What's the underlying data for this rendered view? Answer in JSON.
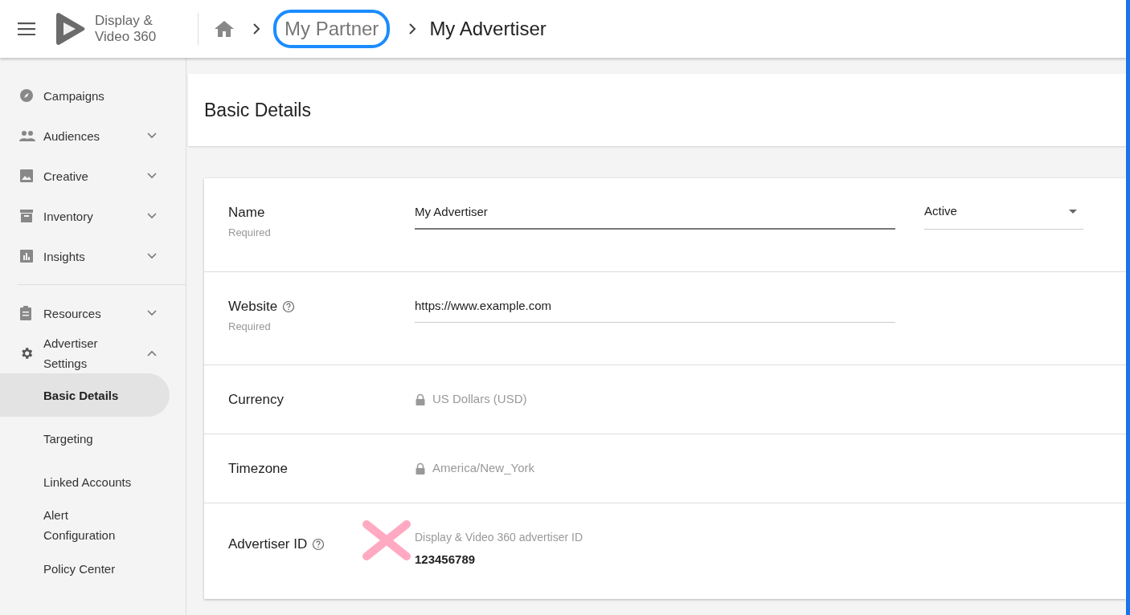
{
  "header": {
    "logo_text": [
      "Display &",
      "Video 360"
    ],
    "breadcrumbs": [
      {
        "label": "My Partner",
        "highlighted": true
      },
      {
        "label": "My Advertiser",
        "highlighted": false
      }
    ]
  },
  "sidebar": {
    "sections": [
      [
        {
          "label": "Campaigns",
          "kind": "link",
          "selected": false
        },
        {
          "label": "Audiences",
          "kind": "group",
          "expanded": false,
          "selected": false
        },
        {
          "label": "Creative",
          "kind": "group",
          "expanded": false,
          "selected": false
        },
        {
          "label": "Inventory",
          "kind": "group",
          "expanded": false,
          "selected": false
        },
        {
          "label": "Insights",
          "kind": "group",
          "expanded": false,
          "selected": false
        }
      ],
      [
        {
          "label": "Resources",
          "kind": "group",
          "expanded": false,
          "selected": false
        },
        {
          "label": "Advertiser Settings",
          "kind": "group",
          "expanded": true,
          "selected": false,
          "children": [
            {
              "label": "Basic Details",
              "selected": true
            },
            {
              "label": "Targeting",
              "selected": false
            },
            {
              "label": "Linked Accounts",
              "selected": false
            },
            {
              "label": "Alert Configuration",
              "selected": false
            },
            {
              "label": "Policy Center",
              "selected": false
            }
          ]
        }
      ]
    ]
  },
  "page_title": "Basic Details",
  "form": {
    "rows": [
      {
        "kind": "input",
        "label": "Name",
        "help": false,
        "note": "Required",
        "value": "My Advertiser",
        "select": "Active"
      },
      {
        "kind": "input",
        "label": "Website",
        "help": true,
        "note": "Required",
        "value": "https://www.example.com"
      },
      {
        "kind": "locked",
        "label": "Currency",
        "help": false,
        "value": "US Dollars (USD)"
      },
      {
        "kind": "locked",
        "label": "Timezone",
        "help": false,
        "value": "America/New_York"
      },
      {
        "kind": "readonly",
        "label": "Advertiser ID",
        "help": true,
        "hint": "Display & Video 360 advertiser ID",
        "value": "123456789",
        "marked": true
      }
    ]
  }
}
